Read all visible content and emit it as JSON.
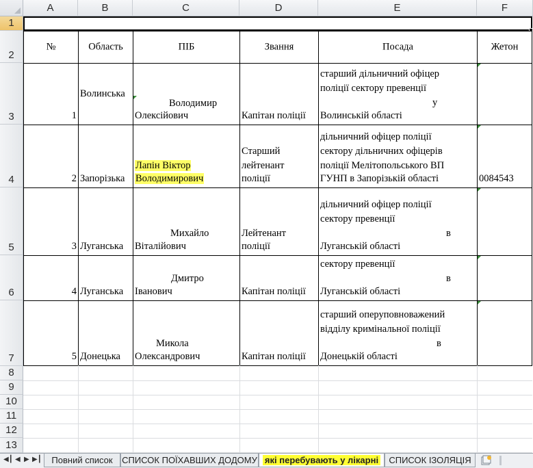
{
  "columns": [
    "A",
    "B",
    "C",
    "D",
    "E",
    "F"
  ],
  "rows": [
    "1",
    "2",
    "3",
    "4",
    "5",
    "6",
    "7",
    "8",
    "9",
    "10",
    "11",
    "12",
    "13"
  ],
  "headers": {
    "num": "№",
    "region": "Область",
    "name": "ПІБ",
    "rank": "Звання",
    "position": "Посада",
    "badge": "Жетон"
  },
  "records": [
    {
      "num": "1",
      "region": "Волинська",
      "name_line1": "Володимир",
      "name_line2": "Олексійович",
      "rank": "Капітан поліції",
      "pos_line1": "старший дільничний офіцер",
      "pos_line2": "поліції сектору превенції",
      "pos_line3": "у",
      "pos_line4": "Волинській області",
      "badge": ""
    },
    {
      "num": "2",
      "region": "Запорізька",
      "name_line1": "Лапін Віктор",
      "name_line2": "Володимирович",
      "rank_line1": "Старший",
      "rank_line2": "лейтенант",
      "rank_line3": "поліції",
      "pos_line1": "дільничний офіцер поліції",
      "pos_line2": "сектору дільничних офіцерів",
      "pos_line3": "поліції Мелітопольського ВП",
      "pos_line4": "ГУНП в Запорізькій області",
      "badge": "0084543"
    },
    {
      "num": "3",
      "region": "Луганська",
      "name_line1": "Михайло",
      "name_line2": "Віталійович",
      "rank_line1": "Лейтенант",
      "rank_line2": "поліції",
      "pos_line1": "дільничний офіцер поліції",
      "pos_line2": "сектору превенції",
      "pos_line3": "в",
      "pos_line4": "Луганській області",
      "badge": ""
    },
    {
      "num": "4",
      "region": "Луганська",
      "name_line1": "Дмитро",
      "name_line2": "Іванович",
      "rank": "Капітан поліції",
      "pos_line1": "сектору превенції",
      "pos_line2": "в",
      "pos_line3": "Луганській області",
      "badge": ""
    },
    {
      "num": "5",
      "region": "Донецька",
      "name_line1": "Микола",
      "name_line2": "Олександрович",
      "rank": "Капітан поліції",
      "pos_line1": "старший оперуповноважений",
      "pos_line2": "відділу кримінальної поліції",
      "pos_line3": "в",
      "pos_line4": "Донецькій області",
      "badge": ""
    }
  ],
  "sheet_tabs": [
    {
      "label": "Повний список",
      "active": false
    },
    {
      "label": "СПИСОК ПОЇХАВШИХ ДОДОМУ",
      "active": false
    },
    {
      "label": "які перебувають у лікарні",
      "active": true
    },
    {
      "label": "СПИСОК ІЗОЛЯЦІЯ",
      "active": false
    }
  ],
  "colors": {
    "highlight": "#ffff66",
    "header_bg": "#e3e6ea",
    "selected_row_header": "#f3d99a"
  }
}
